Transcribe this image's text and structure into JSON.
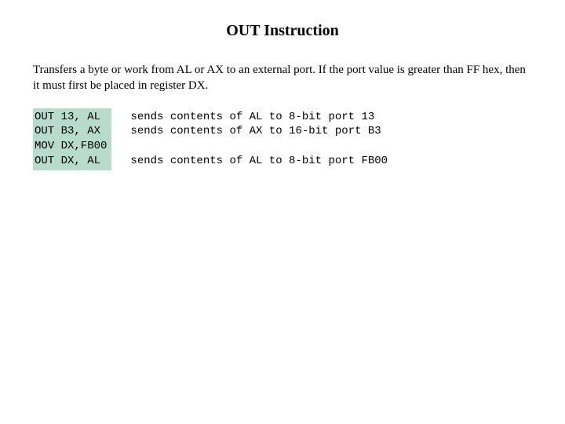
{
  "title": "OUT Instruction",
  "description": "Transfers a byte or work from AL or AX to an external port.  If the port value is greater than FF hex, then it must first be placed in register DX.",
  "code": "OUT 13, AL\nOUT B3, AX\nMOV DX,FB00\nOUT DX, AL",
  "explain": "sends contents of AL to 8-bit port 13\nsends contents of AX to 16-bit port B3\n\nsends contents of AL to 8-bit port FB00"
}
